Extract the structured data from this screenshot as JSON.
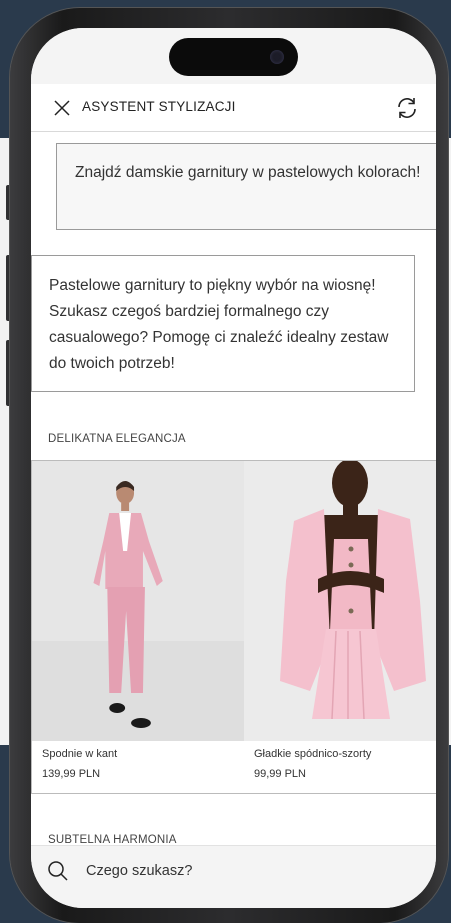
{
  "header": {
    "title": "ASYSTENT STYLIZACJI"
  },
  "chat": {
    "user_message": "Znajdź damskie garnitury w pastelowych kolorach!",
    "assistant_message": "Pastelowe garnitury to piękny wybór na wiosnę! Szukasz czegoś bardziej formalnego czy casualowego? Pomogę ci znaleźć idealny zestaw do twoich potrzeb!"
  },
  "sections": [
    {
      "title": "DELIKATNA ELEGANCJA",
      "products": [
        {
          "name": "Spodnie w kant",
          "price": "139,99 PLN"
        },
        {
          "name": "Gładkie spódnico-szorty",
          "price": "99,99 PLN"
        }
      ]
    },
    {
      "title": "SUBTELNA HARMONIA"
    }
  ],
  "search": {
    "placeholder": "Czego szukasz?"
  },
  "colors": {
    "accent_pink": "#e8a9b9",
    "background": "#2a3a4c"
  },
  "icons": [
    "close-icon",
    "refresh-icon",
    "search-icon"
  ]
}
